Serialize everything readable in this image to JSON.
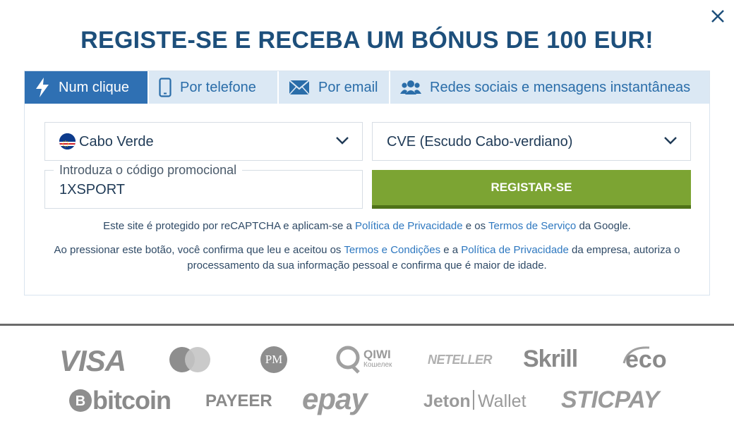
{
  "title": "REGISTE-SE E RECEBA UM BÓNUS DE 100 EUR!",
  "tabs": [
    {
      "label": "Num clique",
      "icon": "lightning-icon",
      "active": true
    },
    {
      "label": "Por telefone",
      "icon": "phone-icon",
      "active": false
    },
    {
      "label": "Por email",
      "icon": "envelope-icon",
      "active": false
    },
    {
      "label": "Redes sociais e mensagens instantâneas",
      "icon": "users-icon",
      "active": false
    }
  ],
  "form": {
    "country": "Cabo Verde",
    "currency": "CVE (Escudo Cabo-verdiano)",
    "promo_label": "Introduza o código promocional",
    "promo_value": "1XSPORT",
    "register_label": "REGISTAR-SE"
  },
  "notes": {
    "recaptcha_1": "Este site é protegido por reCAPTCHA e aplicam-se a",
    "recaptcha_link1": "Política de Privacidade",
    "recaptcha_2": "e os",
    "recaptcha_link2": "Termos de Serviço",
    "recaptcha_3": "da Google.",
    "consent_1": "Ao pressionar este botão, você confirma que leu e aceitou os",
    "consent_link1": "Termos e Condições",
    "consent_2": "e a",
    "consent_link2": "Política de Privacidade",
    "consent_3": "da empresa, autoriza o processamento da sua informação pessoal e confirma que é maior de idade."
  },
  "payments": {
    "visa": "VISA",
    "pm": "PM",
    "qiwi": "QIWI",
    "qiwi_sub": "Кошелек",
    "neteller": "NETELLER",
    "skrill": "Skrill",
    "eco": "eco",
    "bitcoin": "bitcoin",
    "payeer": "PAYEER",
    "epay": "epay",
    "jeton": "Jeton",
    "wallet": "Wallet",
    "sticpay": "STICPAY"
  },
  "colors": {
    "title": "#1d4f7b",
    "tab_active": "#2f70b3",
    "tab_bg": "#dbe8f4",
    "register": "#7ca433",
    "link": "#2e78c0"
  }
}
